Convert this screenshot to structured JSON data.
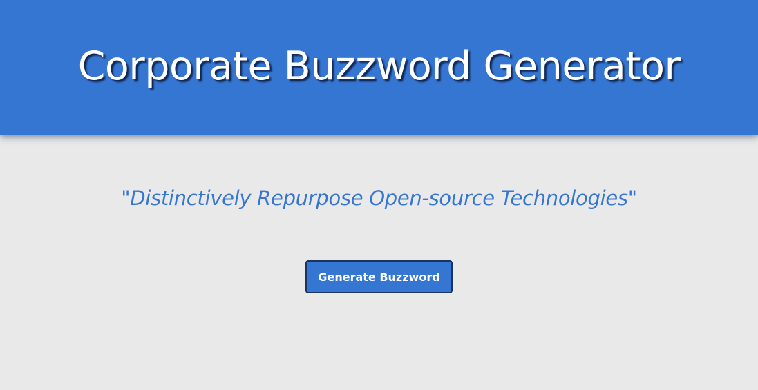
{
  "header": {
    "title": "Corporate Buzzword Generator"
  },
  "main": {
    "buzzword": "\"Distinctively Repurpose Open-source Technologies\"",
    "generate_button_label": "Generate Buzzword"
  },
  "colors": {
    "brand_blue": "#3476d2",
    "background": "#e9e9e9",
    "button_border": "#1a3460",
    "text_on_brand": "#ffffff"
  }
}
